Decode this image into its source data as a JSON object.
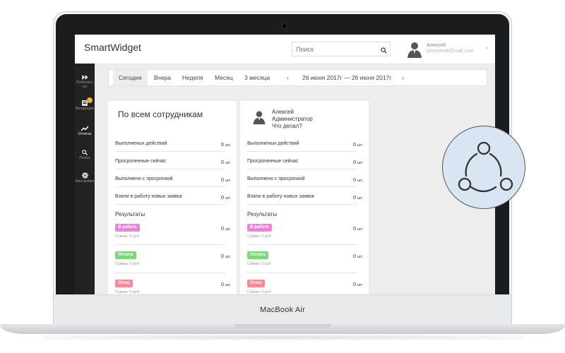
{
  "device": {
    "label": "MacBook Air"
  },
  "app": {
    "brand": "SmartWidget",
    "search": {
      "placeholder": "Поиск",
      "value": ""
    },
    "user": {
      "name": "Алексей",
      "email": "pismomail@mail.com"
    }
  },
  "sidebar": {
    "items": [
      {
        "label": "Работать тут",
        "icon": "fast-forward-icon",
        "active": false
      },
      {
        "label": "Входящие",
        "icon": "inbox-icon",
        "active": false,
        "badge": "1"
      },
      {
        "label": "Отчеты",
        "icon": "trend-icon",
        "active": true
      },
      {
        "label": "Поиск",
        "icon": "search-icon",
        "active": false
      },
      {
        "label": "Настройки",
        "icon": "gear-icon",
        "active": false
      }
    ]
  },
  "filters": {
    "periods": [
      "Сегодня",
      "Вчера",
      "Неделя",
      "Месяц",
      "3 месяца"
    ],
    "active": "Сегодня",
    "prev": "‹",
    "next": "›",
    "range": "26 июня 2017г — 26 июня 2017г"
  },
  "cards": [
    {
      "title": "По всем сотрудникам",
      "rows": [
        {
          "label": "Выполненых действий",
          "value": "0",
          "unit": "шт."
        },
        {
          "label": "Просроченные сейчас",
          "value": "0",
          "unit": "шт."
        },
        {
          "label": "Выполнено с просрочкой",
          "value": "0",
          "unit": "шт."
        },
        {
          "label": "Взяли в работу новых заявок",
          "value": "0",
          "unit": "шт."
        }
      ],
      "results_title": "Результаты",
      "results": [
        {
          "tag": "В работе",
          "color": "#f07fe0",
          "sum": "Сумма: 0 руб",
          "value": "0",
          "unit": "шт."
        },
        {
          "tag": "Оплата",
          "color": "#7ed87b",
          "sum": "Сумма: 0 руб",
          "value": "0",
          "unit": "шт."
        },
        {
          "tag": "Отказ",
          "color": "#f28a9a",
          "sum": "Сумма: 0 руб",
          "value": "0",
          "unit": "шт."
        }
      ]
    },
    {
      "person": {
        "name": "Алексей",
        "role": "Администратор",
        "question": "Что делал?"
      },
      "rows": [
        {
          "label": "Выполненых действий",
          "value": "0",
          "unit": "шт."
        },
        {
          "label": "Просроченные сейчас",
          "value": "0",
          "unit": "шт."
        },
        {
          "label": "Выполнено с просрочкой",
          "value": "0",
          "unit": "шт."
        },
        {
          "label": "Взяли в работу новых заявок",
          "value": "0",
          "unit": "шт."
        }
      ],
      "results_title": "Результаты",
      "results": [
        {
          "tag": "В работе",
          "color": "#f07fe0",
          "sum": "Сумма: 0 руб",
          "value": "0",
          "unit": "шт."
        },
        {
          "tag": "Оплата",
          "color": "#7ed87b",
          "sum": "Сумма: 0 руб",
          "value": "0",
          "unit": "шт."
        },
        {
          "tag": "Отказ",
          "color": "#f28a9a",
          "sum": "Сумма: 0 руб",
          "value": "0",
          "unit": "шт."
        }
      ]
    }
  ],
  "overlay_icon": "share-network-icon"
}
